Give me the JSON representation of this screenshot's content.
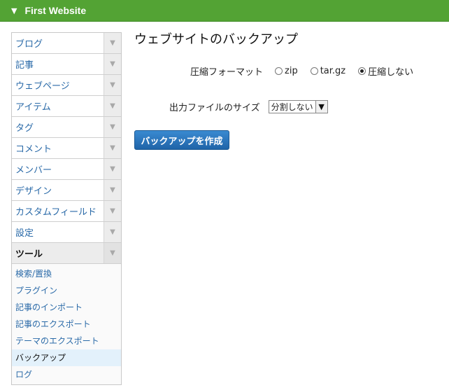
{
  "header": {
    "site_title": "First Website"
  },
  "sidebar": {
    "items": [
      {
        "label": "ブログ"
      },
      {
        "label": "記事"
      },
      {
        "label": "ウェブページ"
      },
      {
        "label": "アイテム"
      },
      {
        "label": "タグ"
      },
      {
        "label": "コメント"
      },
      {
        "label": "メンバー"
      },
      {
        "label": "デザイン"
      },
      {
        "label": "カスタムフィールド"
      },
      {
        "label": "設定"
      },
      {
        "label": "ツール"
      }
    ],
    "tools_submenu": [
      {
        "label": "検索/置換"
      },
      {
        "label": "プラグイン"
      },
      {
        "label": "記事のインポート"
      },
      {
        "label": "記事のエクスポート"
      },
      {
        "label": "テーマのエクスポート"
      },
      {
        "label": "バックアップ"
      },
      {
        "label": "ログ"
      }
    ],
    "arrow_glyph": "▼"
  },
  "main": {
    "title": "ウェブサイトのバックアップ",
    "compression": {
      "label": "圧縮フォーマット",
      "options": [
        "zip",
        "tar.gz",
        "圧縮しない"
      ],
      "selected": "圧縮しない"
    },
    "size": {
      "label": "出力ファイルのサイズ",
      "value": "分割しない"
    },
    "create_button": "バックアップを作成"
  }
}
